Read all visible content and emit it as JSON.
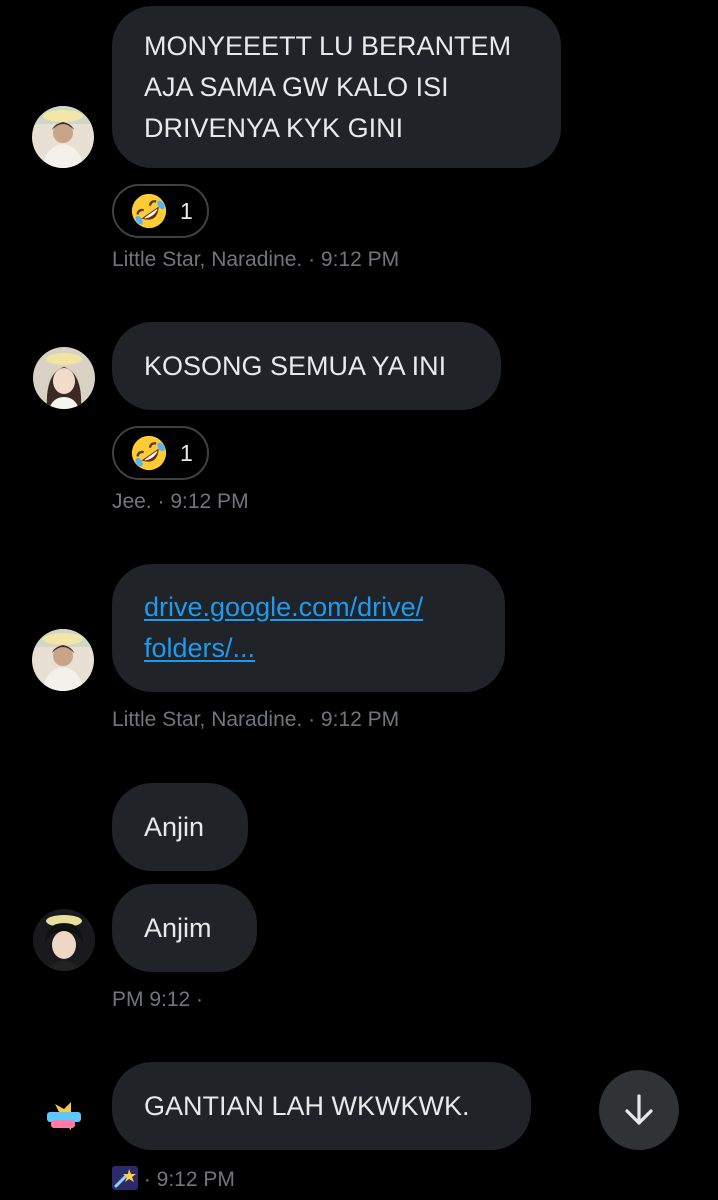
{
  "messages": [
    {
      "lines": [
        "MONYEEETT LU BERANTEM",
        "AJA SAMA GW KALO ISI",
        "DRIVENYA KYK GINI"
      ],
      "reaction": {
        "emoji": "rolling-on-floor-laughing",
        "count": "1"
      },
      "meta": "Little Star, Naradine. · 9:12 PM"
    },
    {
      "lines": [
        "KOSONG SEMUA YA INI"
      ],
      "reaction": {
        "emoji": "rolling-on-floor-laughing",
        "count": "1"
      },
      "meta": "Jee. · 9:12 PM"
    },
    {
      "link_lines": [
        "drive.google.com/drive/",
        "folders/..."
      ],
      "meta": "Little Star, Naradine. · 9:12 PM"
    },
    {
      "bubbles": [
        "Anjin",
        "Anjim"
      ],
      "meta": "PM 9:12 ·"
    },
    {
      "lines": [
        "GANTIAN LAH WKWKWK."
      ],
      "meta": "· 9:12 PM",
      "meta_emoji": "shooting-star"
    }
  ],
  "colors": {
    "background": "#000000",
    "bubble": "#202327",
    "text": "#e7e9ea",
    "meta": "#71767b",
    "link": "#1d9bf0",
    "scroll_button": "#2f3336"
  },
  "icons": {
    "scroll_down": "arrow-down-icon",
    "avatar_badge": "star-badge-icon"
  }
}
